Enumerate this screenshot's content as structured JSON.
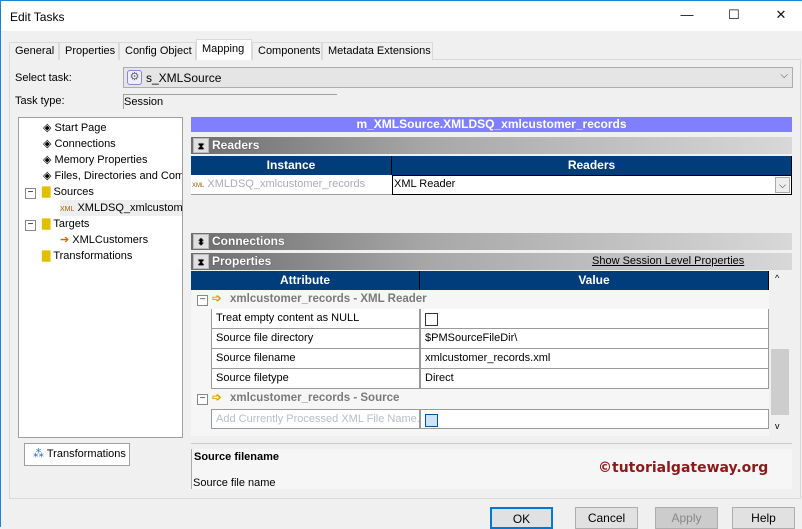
{
  "window": {
    "title": "Edit Tasks",
    "minimize": "—",
    "maximize": "☐",
    "close": "✕"
  },
  "tabs": [
    {
      "label": "General"
    },
    {
      "label": "Properties"
    },
    {
      "label": "Config Object"
    },
    {
      "label": "Mapping",
      "active": true
    },
    {
      "label": "Components"
    },
    {
      "label": "Metadata Extensions"
    }
  ],
  "select_task": {
    "label": "Select task:",
    "value": "s_XMLSource"
  },
  "task_type": {
    "label": "Task type:",
    "value": "Session"
  },
  "tree": {
    "items": [
      {
        "label": "Start Page"
      },
      {
        "label": "Connections"
      },
      {
        "label": "Memory Properties"
      },
      {
        "label": "Files, Directories and Commands"
      },
      {
        "label": "Sources"
      },
      {
        "label": "XMLDSQ_xmlcustomer_records"
      },
      {
        "label": "Targets"
      },
      {
        "label": "XMLCustomers"
      },
      {
        "label": "Transformations"
      }
    ],
    "bottom_tab": "Transformations"
  },
  "main": {
    "header": "m_XMLSource.XMLDSQ_xmlcustomer_records",
    "readers": {
      "title": "Readers",
      "columns": [
        "Instance",
        "Readers"
      ],
      "row": {
        "instance": "XMLDSQ_xmlcustomer_records",
        "reader": "XML Reader"
      }
    },
    "connections": {
      "title": "Connections"
    },
    "properties": {
      "title": "Properties",
      "link": "Show Session Level Properties",
      "columns": [
        "Attribute",
        "Value"
      ],
      "groups": [
        {
          "title": "xmlcustomer_records - XML Reader",
          "rows": [
            {
              "attr": "Treat empty content as NULL",
              "value": "",
              "checkbox": true,
              "checked": false
            },
            {
              "attr": "Source file directory",
              "value": "$PMSourceFileDir\\"
            },
            {
              "attr": "Source filename",
              "value": "xmlcustomer_records.xml"
            },
            {
              "attr": "Source filetype",
              "value": "Direct"
            }
          ]
        },
        {
          "title": "xmlcustomer_records - Source",
          "rows": [
            {
              "attr": "Add Currently Processed XML File Name...",
              "checkbox": true,
              "checked": false,
              "disabled": true
            }
          ]
        }
      ]
    },
    "description": {
      "title": "Source filename",
      "text": "Source file name"
    },
    "watermark": "©tutorialgateway.org"
  },
  "buttons": {
    "ok": "OK",
    "cancel": "Cancel",
    "apply": "Apply",
    "help": "Help"
  },
  "colors": {
    "header_bar": "#8080ff",
    "table_header": "#003d7a",
    "accent": "#1883d7",
    "watermark": "#8b1a1a"
  }
}
